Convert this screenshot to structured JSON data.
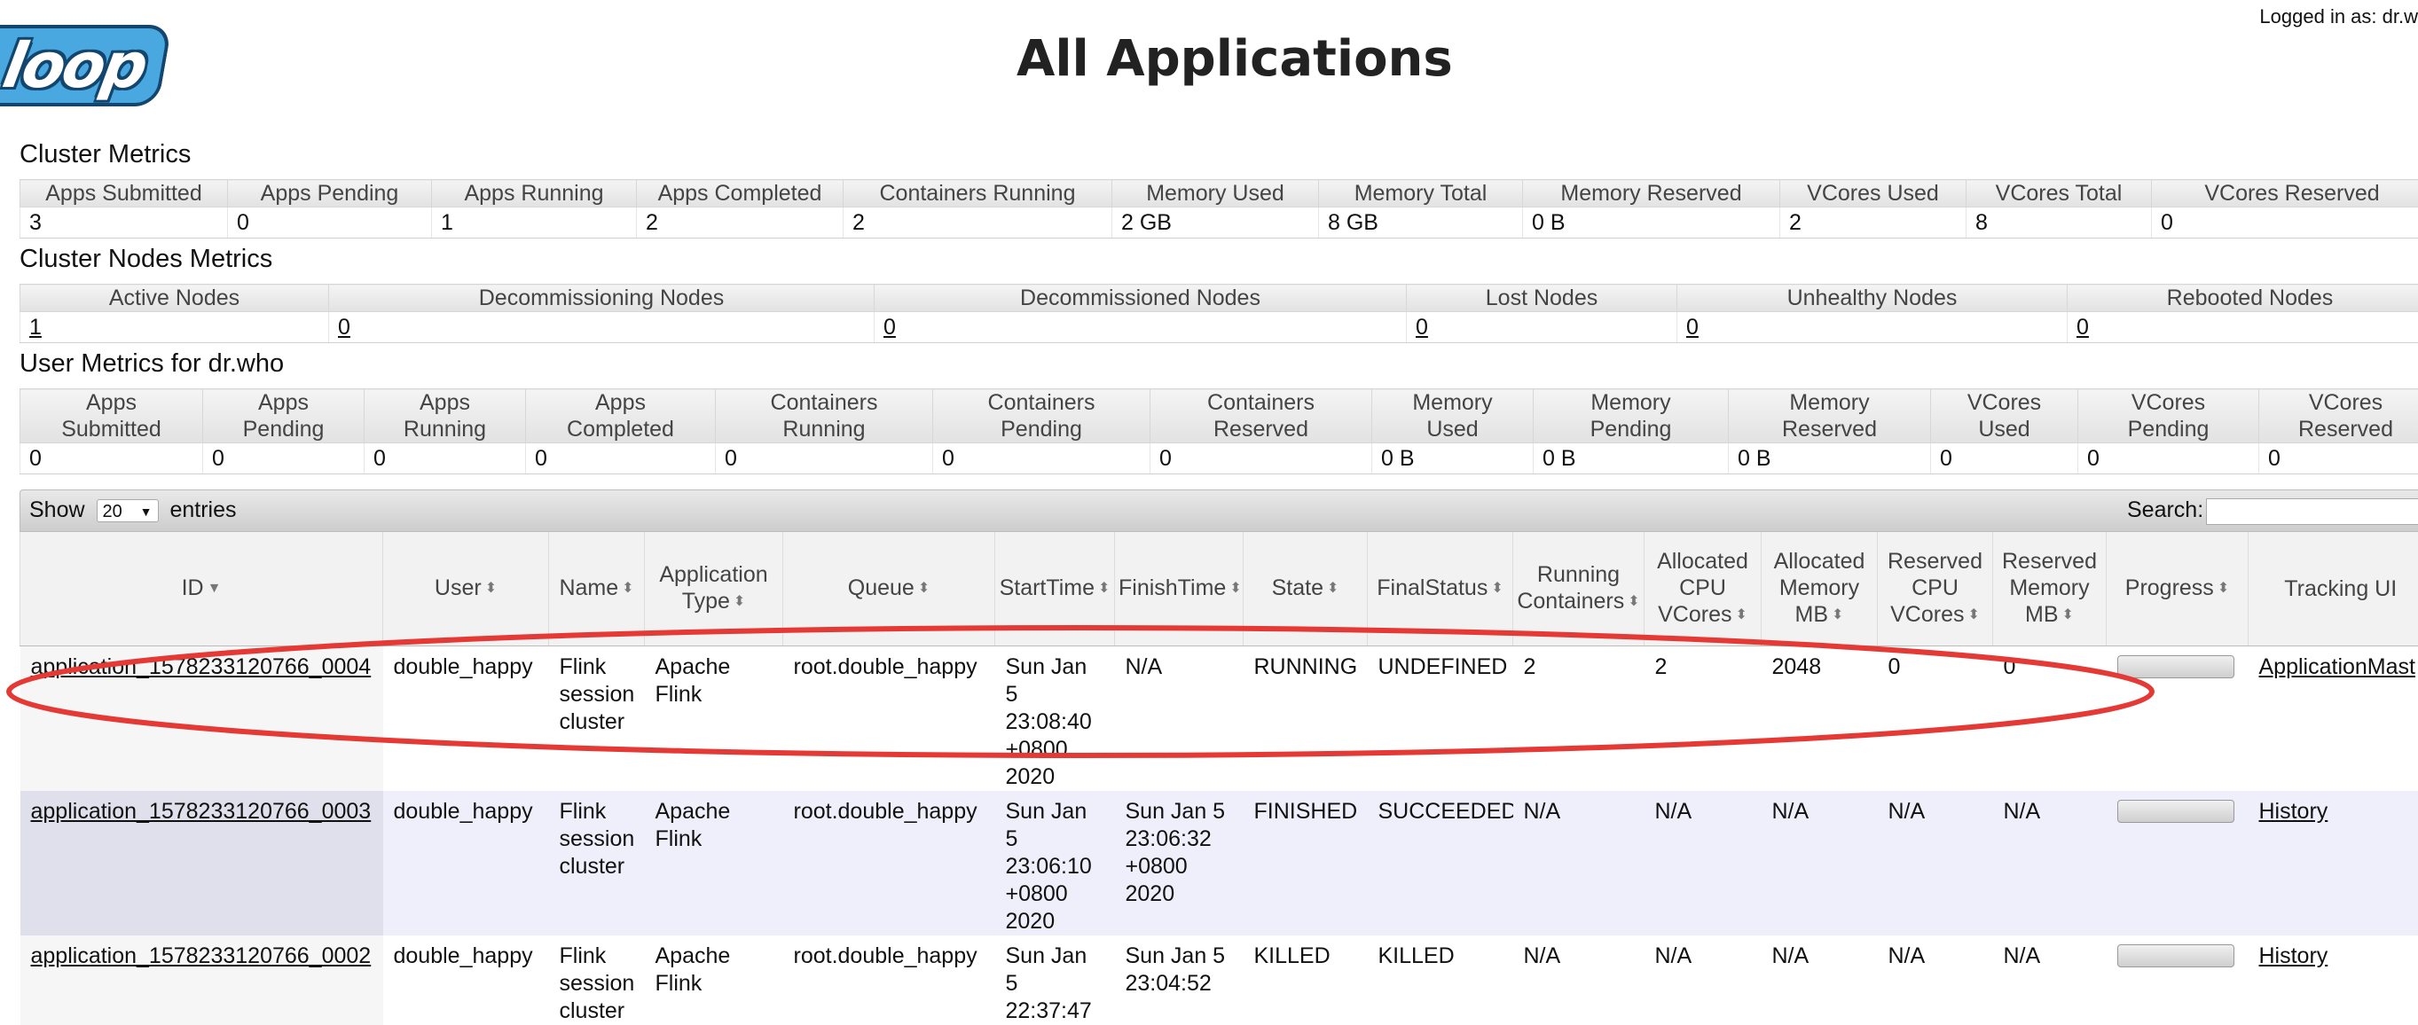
{
  "header": {
    "logo_text": "loop",
    "title": "All Applications",
    "logged_in": "Logged in as: dr.w"
  },
  "cluster_metrics": {
    "title": "Cluster Metrics",
    "headers": [
      "Apps Submitted",
      "Apps Pending",
      "Apps Running",
      "Apps Completed",
      "Containers Running",
      "Memory Used",
      "Memory Total",
      "Memory Reserved",
      "VCores Used",
      "VCores Total",
      "VCores Reserved"
    ],
    "values": [
      "3",
      "0",
      "1",
      "2",
      "2",
      "2 GB",
      "8 GB",
      "0 B",
      "2",
      "8",
      "0"
    ]
  },
  "cluster_nodes_metrics": {
    "title": "Cluster Nodes Metrics",
    "headers": [
      "Active Nodes",
      "Decommissioning Nodes",
      "Decommissioned Nodes",
      "Lost Nodes",
      "Unhealthy Nodes",
      "Rebooted Nodes"
    ],
    "values": [
      "1",
      "0",
      "0",
      "0",
      "0",
      "0"
    ]
  },
  "user_metrics": {
    "title": "User Metrics for dr.who",
    "headers": [
      [
        "Apps",
        "Submitted"
      ],
      [
        "Apps",
        "Pending"
      ],
      [
        "Apps",
        "Running"
      ],
      [
        "Apps",
        "Completed"
      ],
      [
        "Containers",
        "Running"
      ],
      [
        "Containers",
        "Pending"
      ],
      [
        "Containers",
        "Reserved"
      ],
      [
        "Memory",
        "Used"
      ],
      [
        "Memory",
        "Pending"
      ],
      [
        "Memory",
        "Reserved"
      ],
      [
        "VCores",
        "Used"
      ],
      [
        "VCores",
        "Pending"
      ],
      [
        "VCores",
        "Reserved"
      ]
    ],
    "values": [
      "0",
      "0",
      "0",
      "0",
      "0",
      "0",
      "0",
      "0 B",
      "0 B",
      "0 B",
      "0",
      "0",
      "0"
    ]
  },
  "apps_controls": {
    "show_label": "Show",
    "entries_value": "20",
    "entries_label": "entries",
    "search_label": "Search:"
  },
  "apps_table": {
    "headers": [
      [
        "ID"
      ],
      [
        "User"
      ],
      [
        "Name"
      ],
      [
        "Application",
        "Type"
      ],
      [
        "Queue"
      ],
      [
        "StartTime"
      ],
      [
        "FinishTime"
      ],
      [
        "State"
      ],
      [
        "FinalStatus"
      ],
      [
        "Running",
        "Containers"
      ],
      [
        "Allocated",
        "CPU",
        "VCores"
      ],
      [
        "Allocated",
        "Memory",
        "MB"
      ],
      [
        "Reserved",
        "CPU",
        "VCores"
      ],
      [
        "Reserved",
        "Memory",
        "MB"
      ],
      [
        "Progress"
      ],
      [
        "Tracking UI"
      ]
    ],
    "rows": [
      {
        "id": "application_1578233120766_0004",
        "user": "double_happy",
        "name": [
          "Flink",
          "session",
          "cluster"
        ],
        "type": [
          "Apache",
          "Flink"
        ],
        "queue": "root.double_happy",
        "start": [
          "Sun Jan 5",
          "23:08:40",
          "+0800",
          "2020"
        ],
        "finish": [
          "N/A"
        ],
        "state": "RUNNING",
        "final_status": "UNDEFINED",
        "running_containers": "2",
        "alloc_vcores": "2",
        "alloc_mem": "2048",
        "res_vcores": "0",
        "res_mem": "0",
        "progress": 0,
        "tracking": "ApplicationMast"
      },
      {
        "id": "application_1578233120766_0003",
        "user": "double_happy",
        "name": [
          "Flink",
          "session",
          "cluster"
        ],
        "type": [
          "Apache",
          "Flink"
        ],
        "queue": "root.double_happy",
        "start": [
          "Sun Jan 5",
          "23:06:10",
          "+0800",
          "2020"
        ],
        "finish": [
          "Sun Jan 5",
          "23:06:32",
          "+0800",
          "2020"
        ],
        "state": "FINISHED",
        "final_status": "SUCCEEDED",
        "running_containers": "N/A",
        "alloc_vcores": "N/A",
        "alloc_mem": "N/A",
        "res_vcores": "N/A",
        "res_mem": "N/A",
        "progress": 0,
        "tracking": "History"
      },
      {
        "id": "application_1578233120766_0002",
        "user": "double_happy",
        "name": [
          "Flink",
          "session",
          "cluster"
        ],
        "type": [
          "Apache",
          "Flink"
        ],
        "queue": "root.double_happy",
        "start": [
          "Sun Jan 5",
          "22:37:47"
        ],
        "finish": [
          "Sun Jan 5",
          "23:04:52"
        ],
        "state": "KILLED",
        "final_status": "KILLED",
        "running_containers": "N/A",
        "alloc_vcores": "N/A",
        "alloc_mem": "N/A",
        "res_vcores": "N/A",
        "res_mem": "N/A",
        "progress": 0,
        "tracking": "History"
      }
    ]
  },
  "colors": {
    "highlight": "#e53935",
    "logo_blue": "#4aa8e0",
    "logo_outline": "#13466e"
  }
}
